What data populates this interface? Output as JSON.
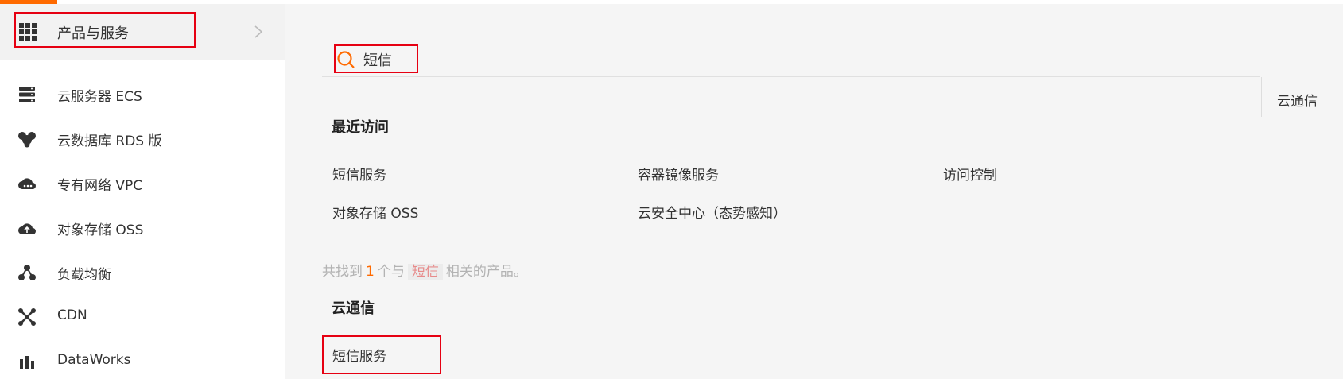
{
  "sidebar": {
    "header_label": "产品与服务",
    "items": [
      {
        "label": "云服务器 ECS",
        "icon": "server-icon"
      },
      {
        "label": "云数据库 RDS 版",
        "icon": "database-icon"
      },
      {
        "label": "专有网络 VPC",
        "icon": "cloud-network-icon"
      },
      {
        "label": "对象存储 OSS",
        "icon": "cloud-storage-icon"
      },
      {
        "label": "负载均衡",
        "icon": "load-balancer-icon"
      },
      {
        "label": "CDN",
        "icon": "cdn-icon"
      },
      {
        "label": "DataWorks",
        "icon": "dataworks-icon"
      }
    ]
  },
  "search": {
    "value": "短信"
  },
  "right_column": {
    "label": "云通信"
  },
  "recent": {
    "title": "最近访问",
    "links": [
      "短信服务",
      "容器镜像服务",
      "访问控制",
      "对象存储 OSS",
      "云安全中心（态势感知）"
    ]
  },
  "results": {
    "prefix": "共找到",
    "count": "1",
    "middle": "个与",
    "keyword": "短信",
    "suffix": "相关的产品。",
    "category": "云通信",
    "items": [
      "短信服务"
    ]
  },
  "colors": {
    "accent": "#ff6a00",
    "highlight_box": "#e60012"
  }
}
